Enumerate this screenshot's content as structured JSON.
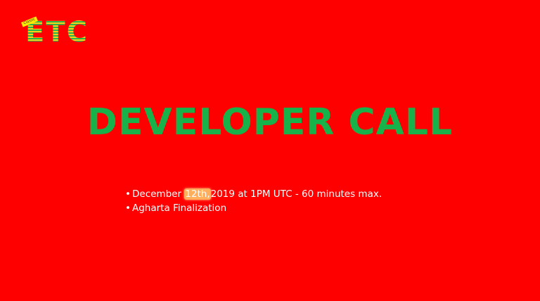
{
  "logo": {
    "text": "ETC",
    "tag": "Classic"
  },
  "title": "DEVELOPER CALL",
  "bullets": {
    "marker": "•",
    "item1": {
      "prefix": "December ",
      "highlight": "12th,",
      "suffix": "2019 at 1PM UTC - 60 minutes max."
    },
    "item2": {
      "text": "Agharta Finalization"
    }
  },
  "colors": {
    "background": "#ff0000",
    "title": "#18b24a",
    "bullet_text": "#ffffff",
    "highlight": "#ffae5c"
  }
}
